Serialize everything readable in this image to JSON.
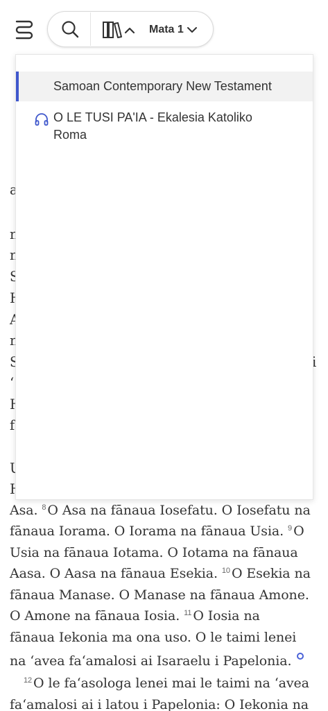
{
  "toolbar": {
    "book_label": "Mata 1"
  },
  "dropdown": {
    "versions": [
      {
        "label": "Samoan Contemporary New Testament"
      },
      {
        "label": "O LE TUSI PA'IA - Ekalesia Katoliko Roma"
      }
    ]
  },
  "scripture": {
    "fragments": [
      "a",
      "n",
      "n",
      "S",
      "H",
      "A",
      "n",
      "S",
      "‘",
      "H",
      "f",
      "U",
      "H",
      "i"
    ],
    "lines": [
      {
        "pre": "Asa. ",
        "v": "8",
        "text": "O Asa na fānaua Iosefatu. O Iosefatu na"
      },
      {
        "text": "fānaua Iorama. O Iorama na fānaua Usia. ",
        "v2": "9",
        "tail": "O"
      },
      {
        "text": "Usia na fānaua Iotama. O Iotama na fānaua"
      },
      {
        "text": "Aasa. O Aasa na fānaua Esekia. ",
        "v2": "10",
        "tail": "O Esekia na"
      },
      {
        "text": "fānaua Manase. O Manase na fānaua Amone."
      },
      {
        "text": "O Amone na fānaua Iosia. ",
        "v2": "11",
        "tail": "O Iosia na"
      },
      {
        "text": "fānaua Iekonia ma ona uso. O le taimi lenei"
      },
      {
        "text": "na ‘avea fa‘amalosi ai Isaraelu i Papelonia."
      },
      {
        "v": "12",
        "text": "O le fa‘asologa lenei mai le taimi na ‘avea"
      },
      {
        "text": "fa‘amalosi ai i latou i Papelonia: O Iekonia na"
      }
    ]
  }
}
